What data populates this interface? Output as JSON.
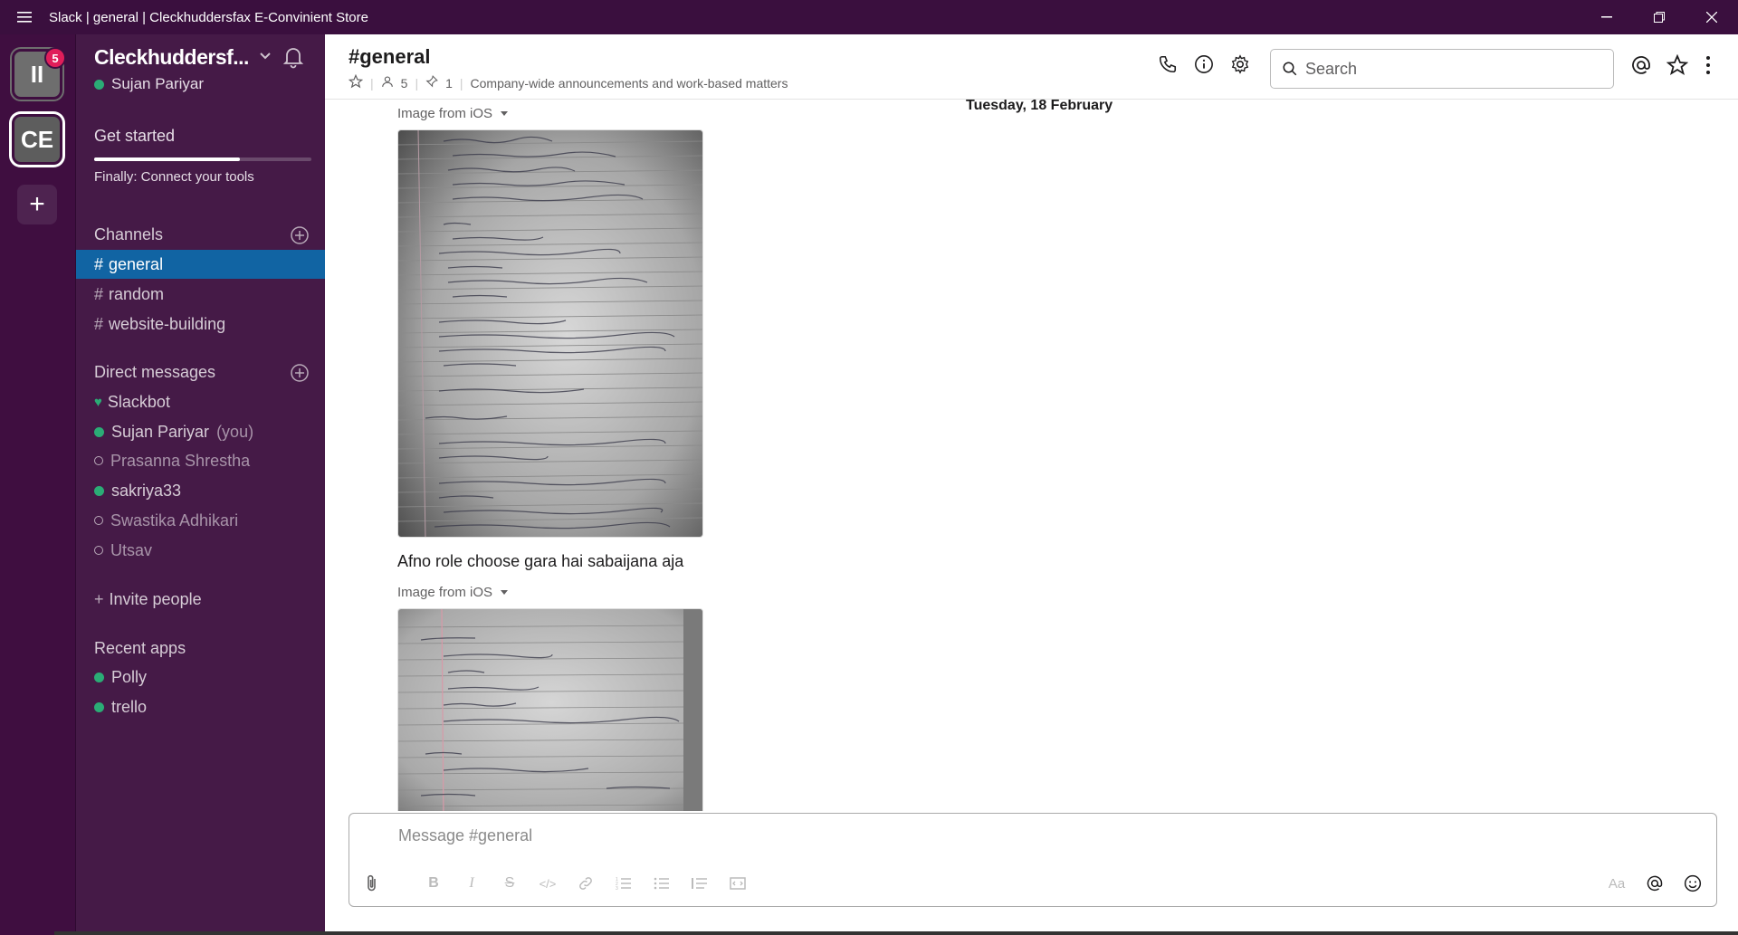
{
  "window": {
    "title": "Slack | general | Cleckhuddersfax E-Convinient Store"
  },
  "rail": {
    "workspace1_initials": "II",
    "workspace1_badge": "5",
    "workspace2_initials": "CE",
    "add_label": "+"
  },
  "sidebar": {
    "workspace_name": "Cleckhuddersf...",
    "user_name": "Sujan Pariyar",
    "get_started": "Get started",
    "progress": 0.67,
    "finally_text": "Finally: Connect your tools",
    "channels_title": "Channels",
    "channels": [
      {
        "name": "general"
      },
      {
        "name": "random"
      },
      {
        "name": "website-building"
      }
    ],
    "dm_title": "Direct messages",
    "dms": [
      {
        "name": "Slackbot"
      },
      {
        "name": "Sujan Pariyar",
        "suffix": "(you)"
      },
      {
        "name": "Prasanna Shrestha"
      },
      {
        "name": "sakriya33"
      },
      {
        "name": "Swastika Adhikari"
      },
      {
        "name": "Utsav"
      }
    ],
    "invite": "Invite people",
    "apps_title": "Recent apps",
    "apps": [
      {
        "name": "Polly"
      },
      {
        "name": "trello"
      }
    ]
  },
  "header": {
    "channel": "#general",
    "members": "5",
    "pins": "1",
    "topic": "Company-wide announcements and work-based matters",
    "search_placeholder": "Search"
  },
  "messages": {
    "date": "Tuesday, 18 February",
    "image1_label": "Image from iOS",
    "text": "Afno role choose gara hai sabaijana aja",
    "image2_label": "Image from iOS"
  },
  "composer": {
    "placeholder": "Message #general",
    "format_label": "Aa"
  },
  "colors": {
    "sidebar": "#451a47",
    "rail": "#3f0e40",
    "active": "#1164a3",
    "online": "#2bac76",
    "badge": "#e01e5a"
  }
}
